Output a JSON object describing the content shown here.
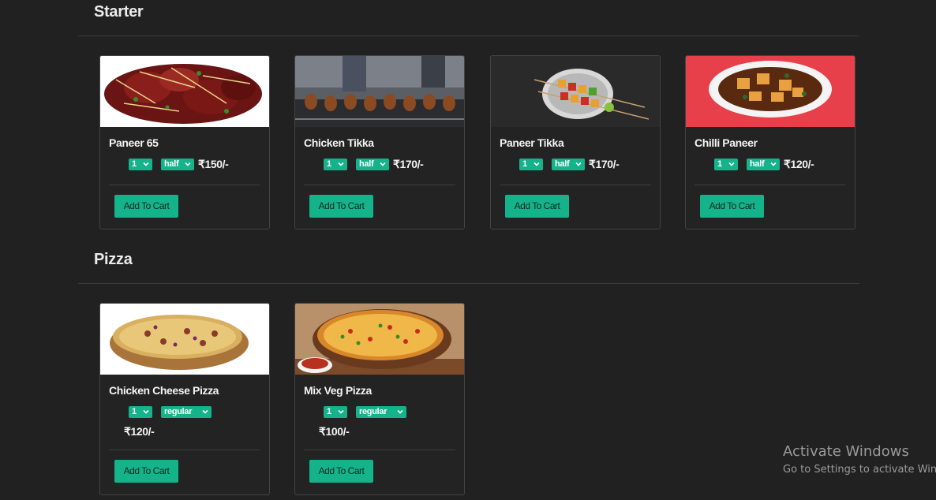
{
  "sections": [
    {
      "title": "Starter",
      "items": [
        {
          "name": "Paneer 65",
          "qty": "1",
          "portion": "half",
          "price": "₹150/-",
          "button": "Add To Cart",
          "image": "fried-paneer-image"
        },
        {
          "name": "Chicken Tikka",
          "qty": "1",
          "portion": "half",
          "price": "₹170/-",
          "button": "Add To Cart",
          "image": "chicken-skewers-image"
        },
        {
          "name": "Paneer Tikka",
          "qty": "1",
          "portion": "half",
          "price": "₹170/-",
          "button": "Add To Cart",
          "image": "paneer-skewers-image"
        },
        {
          "name": "Chilli Paneer",
          "qty": "1",
          "portion": "half",
          "price": "₹120/-",
          "button": "Add To Cart",
          "image": "chilli-paneer-bowl-image"
        }
      ]
    },
    {
      "title": "Pizza",
      "items": [
        {
          "name": "Chicken Cheese Pizza",
          "qty": "1",
          "portion": "regular",
          "price": "₹120/-",
          "button": "Add To Cart",
          "image": "chicken-pizza-image"
        },
        {
          "name": "Mix Veg Pizza",
          "qty": "1",
          "portion": "regular",
          "price": "₹100/-",
          "button": "Add To Cart",
          "image": "veg-pizza-image"
        }
      ]
    }
  ],
  "watermark": {
    "title": "Activate Windows",
    "subtitle": "Go to Settings to activate Windows."
  },
  "colors": {
    "background": "#212121",
    "accent": "#14b38a",
    "card_border": "#434343"
  }
}
